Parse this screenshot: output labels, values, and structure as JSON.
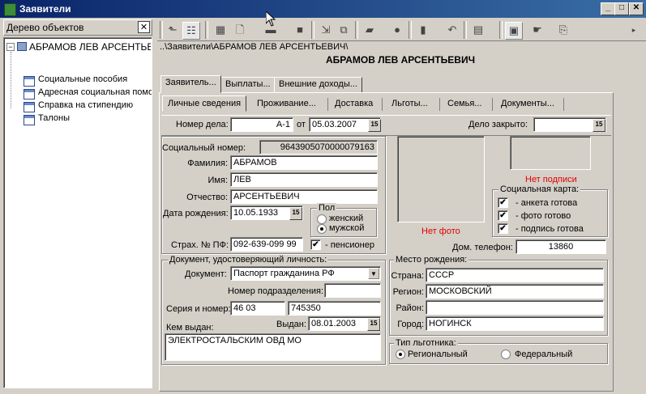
{
  "window": {
    "title": "Заявители"
  },
  "left_panel": {
    "title": "Дерево объектов",
    "root": "АБРАМОВ ЛЕВ АРСЕНТЬЕВИЧ",
    "items": [
      {
        "label": "Социальные пособия"
      },
      {
        "label": "Адресная социальная помо"
      },
      {
        "label": "Справка на стипендию"
      },
      {
        "label": "Талоны"
      }
    ]
  },
  "breadcrumb": "..\\Заявители\\АБРАМОВ ЛЕВ АРСЕНТЬЕВИЧ\\",
  "header": {
    "person_name": "АБРАМОВ ЛЕВ АРСЕНТЬЕВИЧ"
  },
  "tabs": [
    "Заявитель...",
    "Выплаты...",
    "Внешние доходы..."
  ],
  "subtabs": [
    "Личные сведения",
    "Проживание...",
    "Доставка",
    "Льготы...",
    "Семья...",
    "Документы..."
  ],
  "case": {
    "number_label": "Номер дела:",
    "number": "А-1",
    "date_label": "от",
    "date": "05.03.2007",
    "closed_label": "Дело закрыто:",
    "closed": ""
  },
  "calendar_icon_text": "15",
  "person": {
    "social_number_label": "Социальный номер:",
    "social_number": "9643905070000079163",
    "surname_label": "Фамилия:",
    "surname": "АБРАМОВ",
    "name_label": "Имя:",
    "name": "ЛЕВ",
    "patronymic_label": "Отчество:",
    "patronymic": "АРСЕНТЬЕВИЧ",
    "birth_label": "Дата рождения:",
    "birth": "10.05.1933",
    "snils_label": "Страх. № ПФ:",
    "snils": "092-639-099 99",
    "pensioner_label": "- пенсионер",
    "gender": {
      "title": "Пол",
      "female": "женский",
      "male": "мужской",
      "selected": "male"
    }
  },
  "photo": {
    "no_photo": "Нет фото",
    "no_signature": "Нет подписи"
  },
  "social_card": {
    "title": "Социальная карта:",
    "items": [
      "- анкета готова",
      "- фото готово",
      "- подпись готова"
    ]
  },
  "phone": {
    "label": "Дом. телефон:",
    "value": "13860"
  },
  "identity_doc": {
    "title": "Документ, удостоверяющий личность:",
    "doc_label": "Документ:",
    "doc": "Паспорт гражданина РФ",
    "division_label": "Номер подразделения:",
    "division": "",
    "series_label": "Серия и номер:",
    "series": "46 03",
    "number": "745350",
    "issued_label": "Выдан:",
    "issued_date": "08.01.2003",
    "issued_by_label": "Кем выдан:",
    "issued_by": "ЭЛЕКТРОСТАЛЬСКИМ ОВД МО"
  },
  "birthplace": {
    "title": "Место рождения:",
    "country_label": "Страна:",
    "country": "СССР",
    "region_label": "Регион:",
    "region": "МОСКОВСКИЙ",
    "district_label": "Район:",
    "district": "",
    "city_label": "Город:",
    "city": "НОГИНСК"
  },
  "beneficiary": {
    "title": "Тип льготника:",
    "regional": "Региональный",
    "federal": "Федеральный",
    "selected": "regional"
  }
}
